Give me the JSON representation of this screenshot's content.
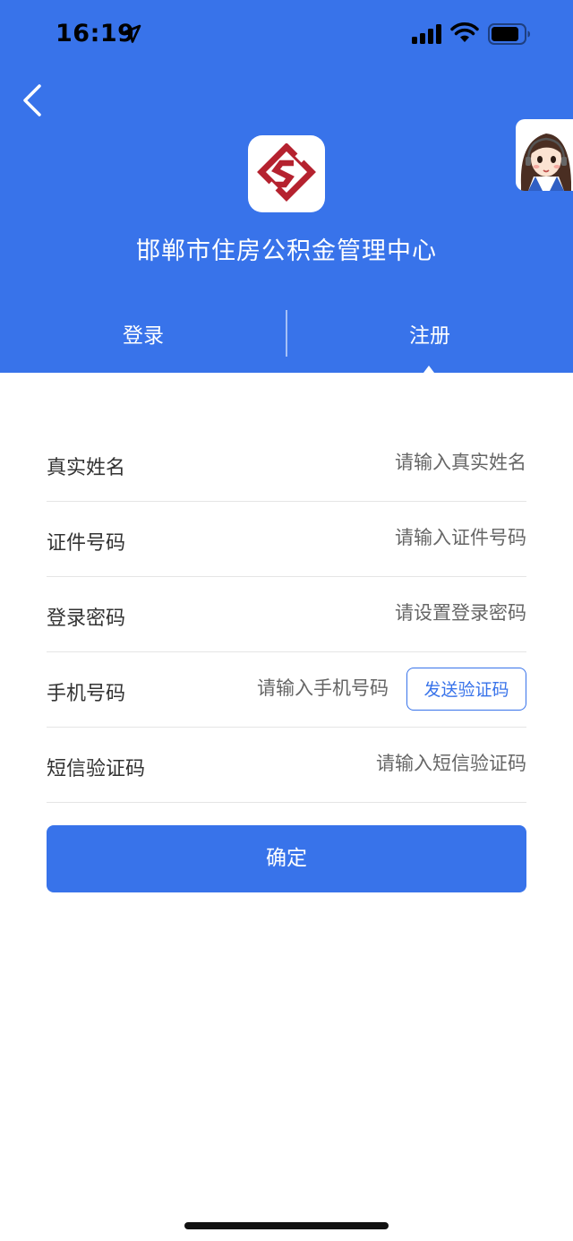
{
  "status_bar": {
    "time": "16:19"
  },
  "header": {
    "org_name": "邯郸市住房公积金管理中心",
    "brand_color": "#3873ea",
    "logo_color": "#b5222f"
  },
  "tabs": [
    {
      "label": "登录",
      "active": false
    },
    {
      "label": "注册",
      "active": true
    }
  ],
  "form": {
    "fields": [
      {
        "label": "真实姓名",
        "placeholder": "请输入真实姓名"
      },
      {
        "label": "证件号码",
        "placeholder": "请输入证件号码"
      },
      {
        "label": "登录密码",
        "placeholder": "请设置登录密码"
      },
      {
        "label": "手机号码",
        "placeholder": "请输入手机号码"
      },
      {
        "label": "短信验证码",
        "placeholder": "请输入短信验证码"
      }
    ],
    "send_code_label": "发送验证码",
    "confirm_label": "确定"
  },
  "icons": {
    "back": "chevron-left-icon",
    "location": "location-arrow-icon",
    "signal": "cellular-signal-icon",
    "wifi": "wifi-icon",
    "battery": "battery-icon",
    "agent": "customer-service-avatar-icon"
  }
}
